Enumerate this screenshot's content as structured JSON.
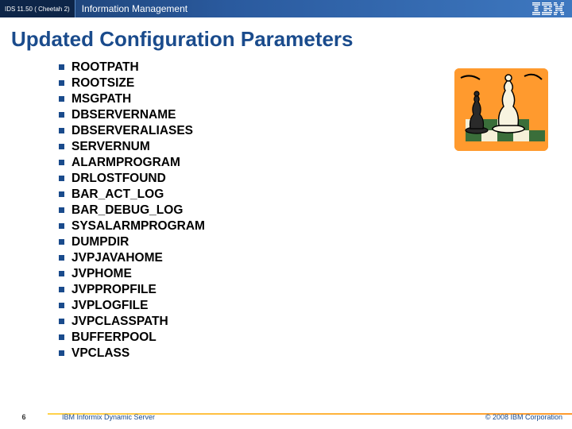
{
  "topbar": {
    "left_label": "IDS 11.50 ( Cheetah 2)",
    "title": "Information Management",
    "logo_name": "IBM"
  },
  "slide": {
    "title": "Updated Configuration Parameters"
  },
  "params": [
    "ROOTPATH",
    "ROOTSIZE",
    "MSGPATH",
    "DBSERVERNAME",
    "DBSERVERALIASES",
    "SERVERNUM",
    "ALARMPROGRAM",
    "DRLOSTFOUND",
    "BAR_ACT_LOG",
    "BAR_DEBUG_LOG",
    "SYSALARMPROGRAM",
    "DUMPDIR",
    "JVPJAVAHOME",
    "JVPHOME",
    "JVPPROPFILE",
    "JVPLOGFILE",
    "JVPCLASSPATH",
    "BUFFERPOOL",
    "VPCLASS"
  ],
  "footer": {
    "page": "6",
    "product": "IBM Informix Dynamic Server",
    "copyright": "© 2008 IBM Corporation"
  },
  "image": {
    "alt": "chess-piece-illustration"
  }
}
